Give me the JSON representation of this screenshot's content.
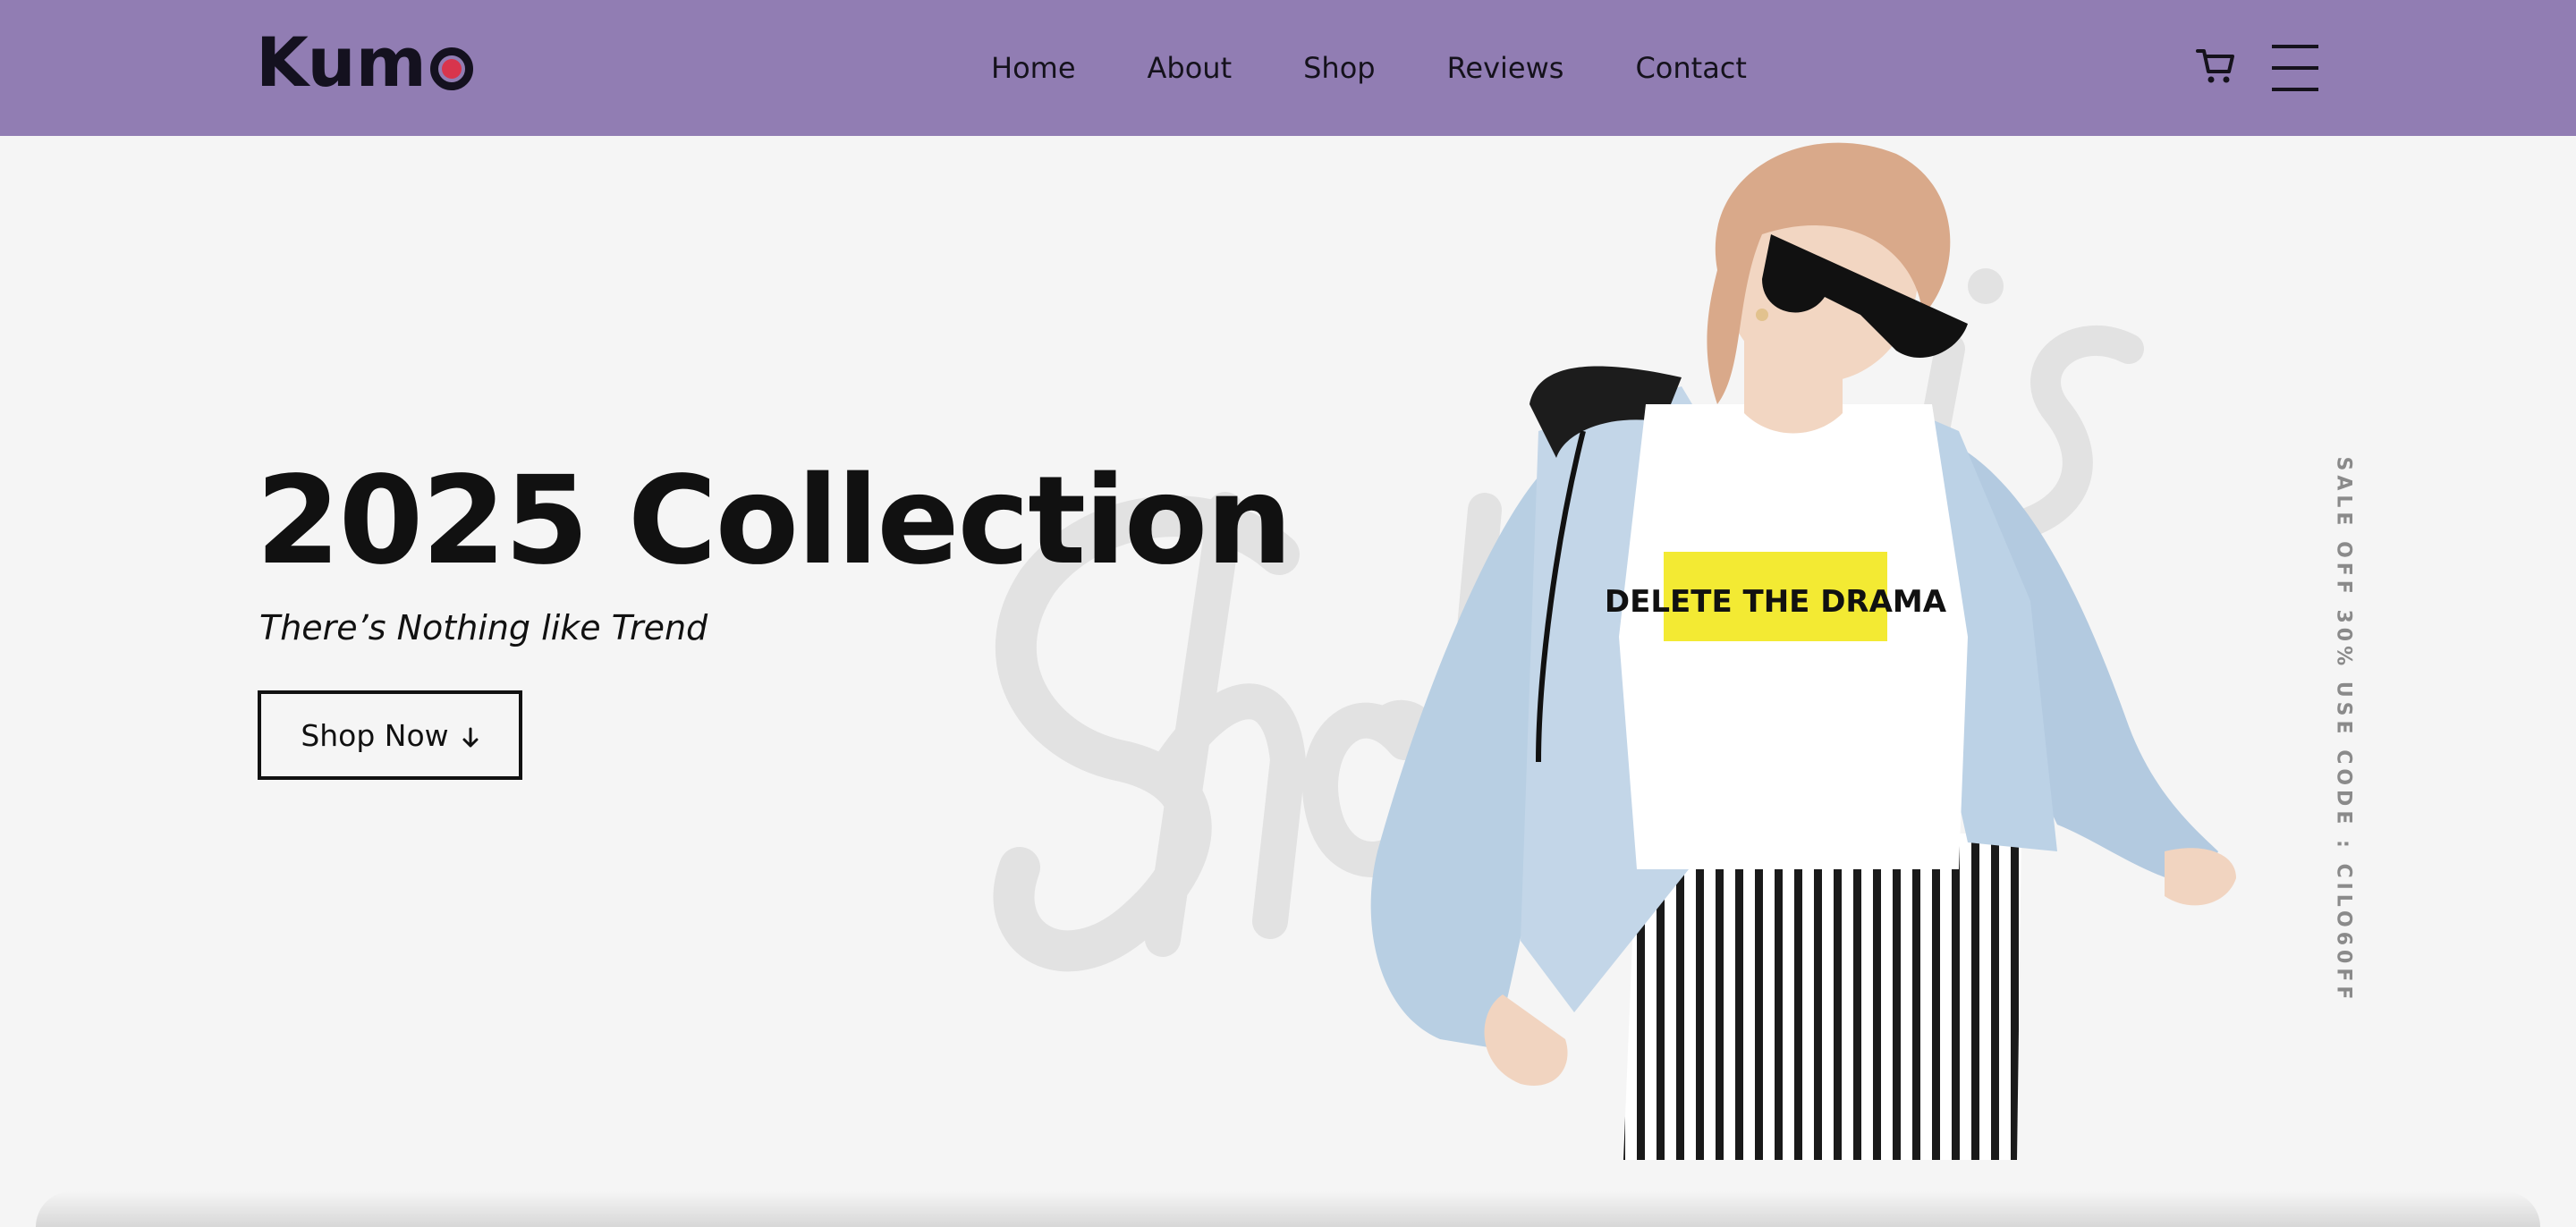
{
  "brand": {
    "name": "Kumo",
    "accent": "#d8354d",
    "header_bg": "#917db3"
  },
  "nav": {
    "items": [
      {
        "label": "Home"
      },
      {
        "label": "About"
      },
      {
        "label": "Shop"
      },
      {
        "label": "Reviews"
      },
      {
        "label": "Contact"
      }
    ],
    "cart_icon": "cart-icon",
    "menu_icon": "hamburger-menu-icon"
  },
  "hero": {
    "title": "2025 Collection",
    "subtitle": "There’s Nothing like Trend",
    "button_label": "Shop Now",
    "button_icon": "arrow-down-icon",
    "background_script": "Shop this",
    "tshirt_text": "DELETE THE DRAMA"
  },
  "promo": {
    "text": "SALE OFF 30% USE CODE : CILO60FF"
  }
}
